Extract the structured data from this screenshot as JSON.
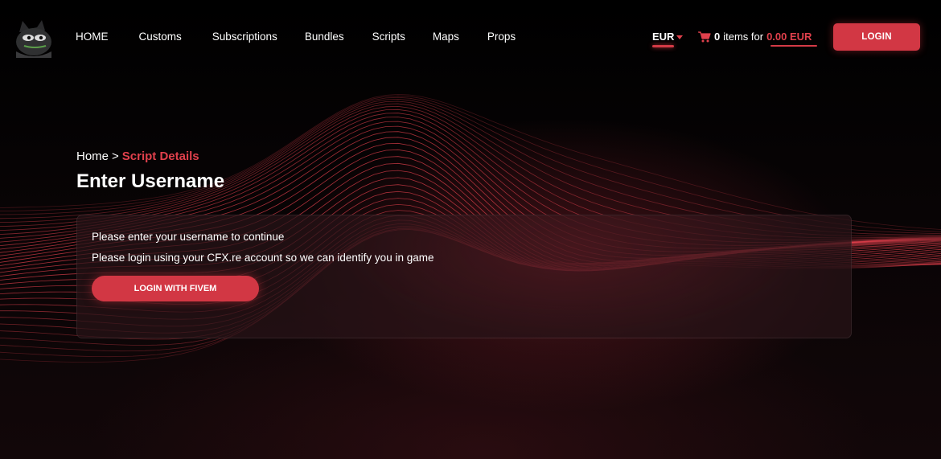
{
  "header": {
    "logo_icon": "frog-mascot-logo",
    "nav": [
      {
        "label": "HOME"
      },
      {
        "label": "Customs"
      },
      {
        "label": "Subscriptions"
      },
      {
        "label": "Bundles"
      },
      {
        "label": "Scripts"
      },
      {
        "label": "Maps"
      },
      {
        "label": "Props"
      }
    ],
    "currency": "EUR",
    "cart": {
      "icon": "cart-icon",
      "count": "0",
      "middle": "items for",
      "total": "0.00 EUR"
    },
    "login_label": "LOGIN"
  },
  "breadcrumb": {
    "home": "Home",
    "separator": ">",
    "current": "Script Details"
  },
  "main": {
    "title": "Enter Username",
    "card": {
      "line1": "Please enter your username to continue",
      "line2": "Please login using your CFX.re account so we can identify you in game",
      "button_label": "LOGIN WITH FIVEM"
    }
  },
  "colors": {
    "accent": "#d23744",
    "accent_text": "#e0404c",
    "background": "#050304"
  }
}
